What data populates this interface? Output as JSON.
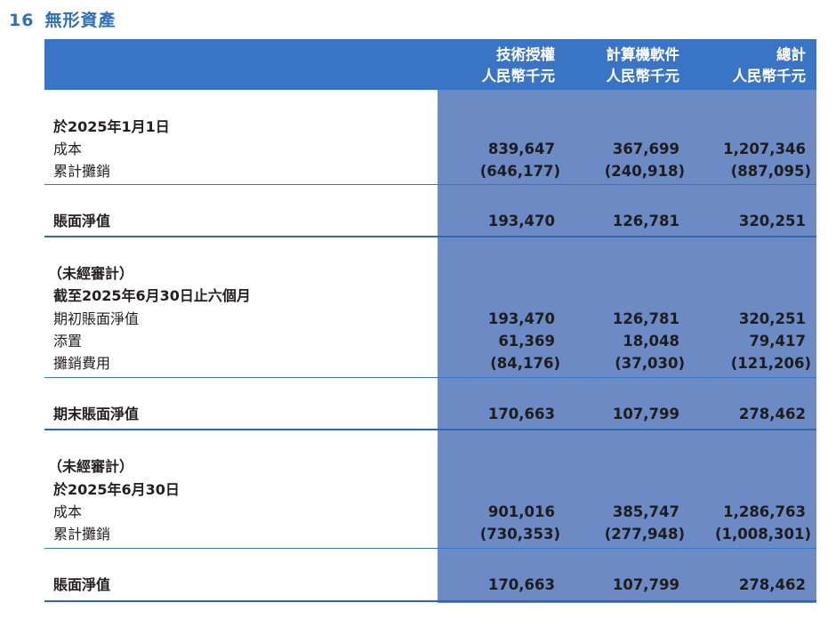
{
  "title": {
    "number": "16",
    "text": "無形資產"
  },
  "columns": [
    {
      "name": "技術授權",
      "unit": "人民幣千元"
    },
    {
      "name": "計算機軟件",
      "unit": "人民幣千元"
    },
    {
      "name": "總計",
      "unit": "人民幣千元"
    }
  ],
  "sections": {
    "s1": {
      "heading": "於2025年1月1日",
      "cost": {
        "label": "成本",
        "values": [
          "839,647",
          "367,699",
          "1,207,346"
        ]
      },
      "amort": {
        "label": "累計攤銷",
        "values": [
          "(646,177)",
          "(240,918)",
          "(887,095)"
        ]
      },
      "net": {
        "label": "賬面淨值",
        "values": [
          "193,470",
          "126,781",
          "320,251"
        ]
      }
    },
    "s2": {
      "note": "（未經審計）",
      "heading": "截至2025年6月30日止六個月",
      "opening": {
        "label": "期初賬面淨值",
        "values": [
          "193,470",
          "126,781",
          "320,251"
        ]
      },
      "additions": {
        "label": "添置",
        "values": [
          "61,369",
          "18,048",
          "79,417"
        ]
      },
      "charge": {
        "label": "攤銷費用",
        "values": [
          "(84,176)",
          "(37,030)",
          "(121,206)"
        ]
      },
      "closing": {
        "label": "期末賬面淨值",
        "values": [
          "170,663",
          "107,799",
          "278,462"
        ]
      }
    },
    "s3": {
      "note": "（未經審計）",
      "heading": "於2025年6月30日",
      "cost": {
        "label": "成本",
        "values": [
          "901,016",
          "385,747",
          "1,286,763"
        ]
      },
      "amort": {
        "label": "累計攤銷",
        "values": [
          "(730,353)",
          "(277,948)",
          "(1,008,301)"
        ]
      },
      "net": {
        "label": "賬面淨值",
        "values": [
          "170,663",
          "107,799",
          "278,462"
        ]
      }
    }
  }
}
